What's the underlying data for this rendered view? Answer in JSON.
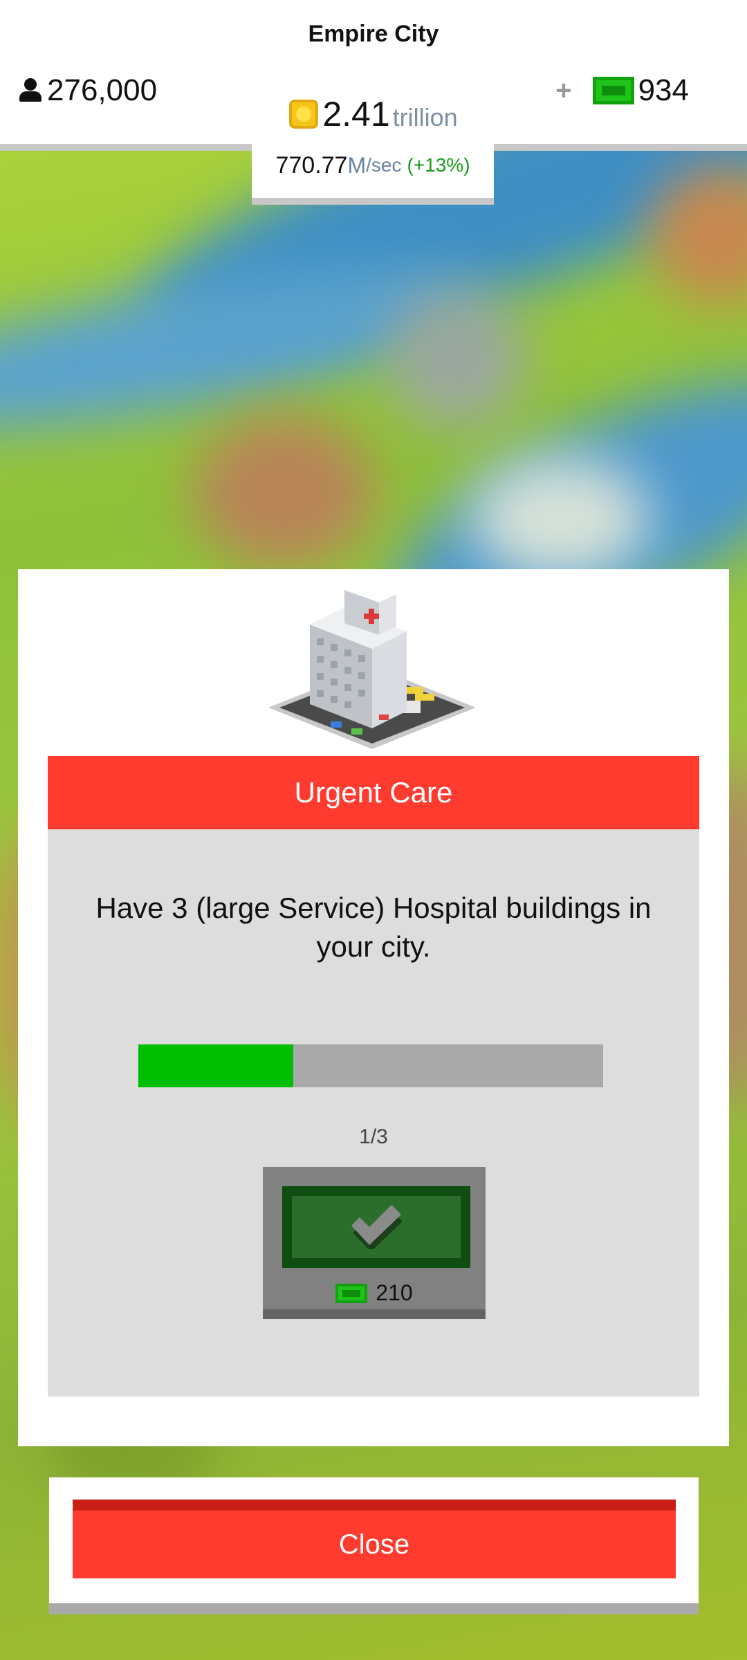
{
  "header": {
    "city_name": "Empire City",
    "population": "276,000",
    "coins": {
      "value": "2.41",
      "unit": "trillion"
    },
    "rate": {
      "value": "770.77",
      "unit": "M",
      "per": "/sec",
      "bonus": "(+13%)"
    },
    "cash_plus": "+",
    "cash": "934"
  },
  "modal": {
    "title": "Urgent Care",
    "description": "Have 3 (large Service) Hospital buildings in your city.",
    "progress": {
      "current": 1,
      "total": 3,
      "text": "1/3",
      "fraction": 0.333
    },
    "reward": "210",
    "close_label": "Close"
  },
  "colors": {
    "accent_red": "#ff3b2f",
    "progress_green": "#00bd00",
    "cash_green": "#1fc31a",
    "claim_green": "#2b6e2b"
  },
  "icons": [
    "person-icon",
    "coin-icon",
    "cash-icon",
    "plus-icon",
    "check-icon",
    "hospital-building-icon"
  ]
}
